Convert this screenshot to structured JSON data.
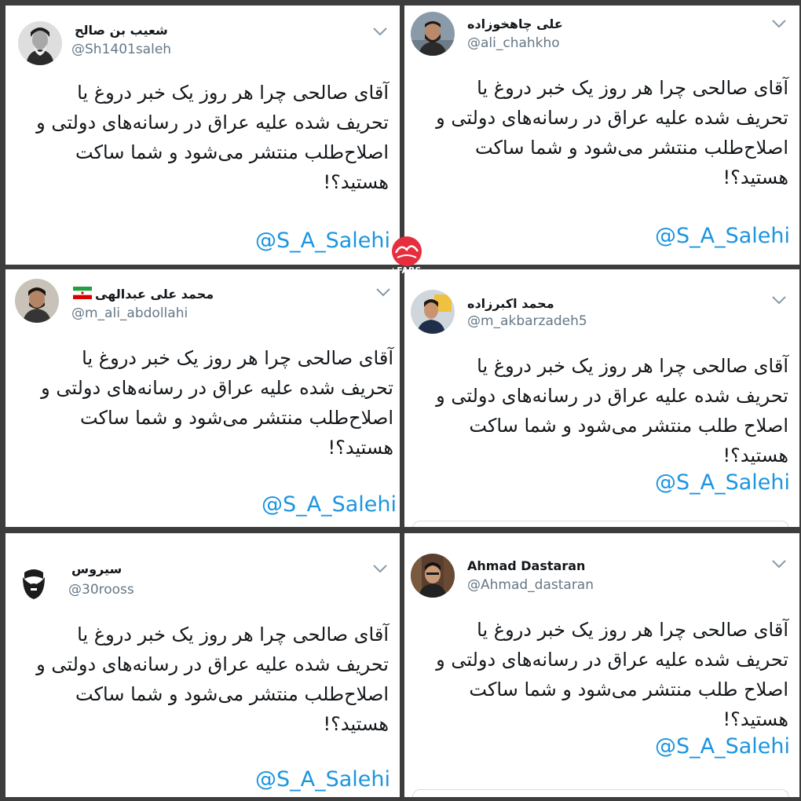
{
  "colors": {
    "background": "#3d3d3d",
    "card": "#ffffff",
    "name_text": "#14171a",
    "handle_text": "#657786",
    "mention": "#1b95e0",
    "logo_red": "#e62e3e"
  },
  "tweets": [
    {
      "name": "شعیب بن صالح",
      "handle": "@Sh1401saleh",
      "lines": [
        "آقای صالحی چرا هر روز یک خبر دروغ یا",
        "تحریف شده علیه عراق در رسانه‌های دولتی و",
        "اصلاح‌طلب منتشر می‌شود و شما ساکت",
        "هستید؟!"
      ],
      "mention": "@S_A_Salehi",
      "avatar_icon": "portrait-icon"
    },
    {
      "name": "علی چاهخوزاده",
      "handle": "@ali_chahkho",
      "lines": [
        "آقای صالحی چرا هر روز یک خبر دروغ یا",
        "تحریف شده علیه عراق در رسانه‌های دولتی و",
        "اصلاح‌طلب منتشر می‌شود و شما ساکت",
        "هستید؟!"
      ],
      "mention": "@S_A_Salehi",
      "avatar_icon": "portrait-icon"
    },
    {
      "name": "محمد علی عبدالهی",
      "handle": "@m_ali_abdollahi",
      "lines": [
        "آقای صالحی چرا هر روز یک خبر دروغ یا",
        "تحریف شده علیه عراق در رسانه‌های دولتی و",
        "اصلاح‌طلب منتشر می‌شود و شما ساکت",
        "هستید؟!"
      ],
      "mention": "@S_A_Salehi",
      "avatar_icon": "portrait-icon",
      "flag_icon": "iran-flag-icon"
    },
    {
      "name": "محمد اکبرزاده",
      "handle": "@m_akbarzadeh5",
      "lines": [
        "آقای صالحی چرا هر روز یک خبر دروغ یا",
        "تحریف شده علیه عراق در رسانه‌های دولتی و",
        "اصلاح طلب منتشر می‌شود و شما ساکت",
        "هستید؟!"
      ],
      "mention": "@S_A_Salehi",
      "avatar_icon": "portrait-icon"
    },
    {
      "name": "سیروس",
      "handle": "@30rooss",
      "lines": [
        "آقای صالحی چرا هر روز یک خبر دروغ یا",
        "تحریف شده علیه عراق در رسانه‌های دولتی و",
        "اصلاح‌طلب منتشر می‌شود و شما ساکت",
        "هستید؟!"
      ],
      "mention": "@S_A_Salehi",
      "avatar_icon": "beard-icon"
    },
    {
      "name": "Ahmad Dastaran",
      "handle": "@Ahmad_dastaran",
      "lines": [
        "آقای صالحی چرا هر روز یک خبر دروغ یا",
        "تحریف شده علیه عراق در رسانه‌های دولتی و",
        "اصلاح طلب منتشر می‌شود و شما ساکت",
        "هستید؟!"
      ],
      "mention": "@S_A_Salehi",
      "avatar_icon": "portrait-icon"
    }
  ],
  "watermark": {
    "brand_text": "+FARS",
    "logo_icon": "fars-news-logo-icon"
  }
}
